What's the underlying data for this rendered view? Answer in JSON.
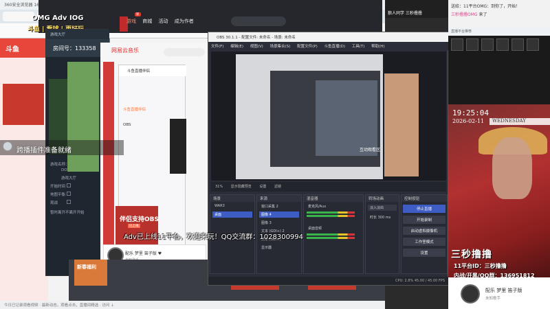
{
  "browser": {
    "title": "360安全浏览器 16.1",
    "status_text": "今日已记录观看视频 · 最新动态，观看点击，直播间精选 · 访问 ↓"
  },
  "site": {
    "logo": "斗鱼"
  },
  "platform": {
    "ad_line1": "OMG Adv IOG",
    "ad_line2": "斗鱼 | 看球 | 更好玩",
    "nav": [
      "游戏",
      "商城",
      "活动",
      "成为作者"
    ],
    "nav_badge": "新"
  },
  "launcher": {
    "title": "游戏大厅",
    "room_label": "房间号：",
    "room_id": "133358",
    "map_caption": "DOTA OMG5 ADV",
    "fields": [
      "游戏名称：",
      "DOTA OMG506 ADV",
      "游戏大厅",
      "开始时间",
      "地图平衡",
      "观战",
      "确认局数",
      "暂时离开不离开开始"
    ]
  },
  "plugin": {
    "text_prefix": "跨播插件",
    "text_rest": "跨播插件准备就绪"
  },
  "netease": {
    "title": "网易云音乐"
  },
  "douyu": {
    "title": "斗鱼直播伴侣",
    "menu_live": "斗鱼直播伴侣",
    "menu_obs": "OBS"
  },
  "promo": {
    "title": "伴侣支持OBS",
    "badge": "已上线",
    "adv_line": "Adv已上线11平台，欢迎来玩！QQ交流群：1028300994",
    "gift_text": "新春福利"
  },
  "mini_music": {
    "track": "配乐  梦里 笛子版 ♥",
    "artist": "未知歌手"
  },
  "obs": {
    "title": "OBS 30.1.1 - 配置文件: 未命名 - 场景: 未命名",
    "menu": [
      "文件(F)",
      "编辑(E)",
      "视图(V)",
      "场景集合(S)",
      "配置文件(P)",
      "斗鱼直播(D)",
      "工具(T)",
      "帮助(H)"
    ],
    "interact_label": "互动观看区",
    "toolbar": [
      "31%",
      "显示隐藏预览",
      "设置",
      "滤镜"
    ],
    "docks": {
      "scenes": {
        "title": "场景",
        "items": [
          "WAR3",
          "桌面"
        ]
      },
      "sources": {
        "title": "来源",
        "items": [
          "窗口采集 2",
          "图像 4",
          "图像 3",
          "文本 (GDI+) 2",
          "文本 (GDI+)",
          "显示器"
        ]
      },
      "mixer": {
        "title": "混音器",
        "items": [
          "麦克风/Aux",
          "桌面音频"
        ]
      },
      "transitions": {
        "title": "转场动画",
        "items": [
          "淡入淡出",
          "时长  300 ms"
        ]
      },
      "controls": {
        "title": "控制按钮",
        "buttons": [
          "停止直播",
          "开始录制",
          "启动虚拟摄像机",
          "工作室模式",
          "设置"
        ]
      }
    },
    "status": "CPU: 2.8%   45.00 / 45.00 FPS"
  },
  "overlay": {
    "text": "狼人同学 三秒撸撸"
  },
  "chat": {
    "line1": "送给：11平台OMG：到你了，开始！",
    "line2_name": "三秒撸撸OMG",
    "line2_rest": " 来了",
    "badge": "直播平台推荐"
  },
  "hero": {
    "time": "19:25:04",
    "date": "2026-02-11",
    "weekday": "WEDNESDAY",
    "streamer": "三秒撸撸",
    "info1": "11平台ID：三秒撸撸",
    "info2": "内战/开黑/QQ群：136951812"
  },
  "right_music": {
    "track": "配乐  梦里 笛子版",
    "artist": "未知歌手"
  }
}
